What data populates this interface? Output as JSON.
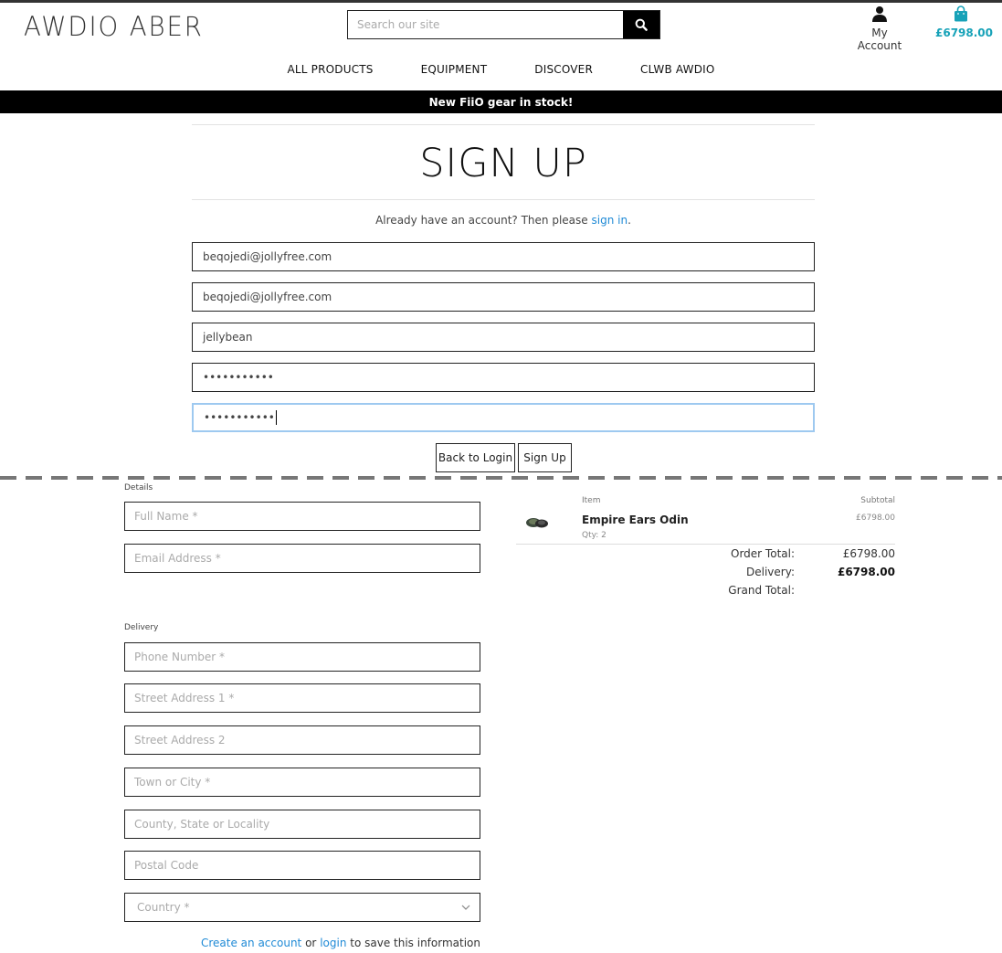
{
  "header": {
    "logo": "AWDIO ABER",
    "search_placeholder": "Search our site",
    "account_label": "My Account",
    "bag_total": "£6798.00"
  },
  "nav": {
    "items": [
      "ALL PRODUCTS",
      "EQUIPMENT",
      "DISCOVER",
      "CLWB AWDIO"
    ]
  },
  "banner": "New FiiO gear in stock!",
  "signup": {
    "title": "SIGN UP",
    "already_text": "Already have an account? Then please",
    "sign_in_link": "sign in",
    "period": ".",
    "email": "beqojedi@jollyfree.com",
    "email_confirm": "beqojedi@jollyfree.com",
    "username": "jellybean",
    "password": "•••••••••••",
    "password_confirm": "•••••••••••",
    "back_button": "Back to Login",
    "signup_button": "Sign Up"
  },
  "checkout": {
    "details_label": "Details",
    "full_name_placeholder": "Full Name *",
    "email_placeholder": "Email Address *",
    "delivery_label": "Delivery",
    "phone_placeholder": "Phone Number *",
    "street1_placeholder": "Street Address 1 *",
    "street2_placeholder": "Street Address 2",
    "town_placeholder": "Town or City *",
    "county_placeholder": "County, State or Locality",
    "postcode_placeholder": "Postal Code",
    "country_placeholder": "Country *",
    "save_create": "Create an account",
    "save_or": "or",
    "save_login": "login",
    "save_rest": "to save this information"
  },
  "summary": {
    "item_header": "Item",
    "subtotal_header": "Subtotal",
    "item_name": "Empire Ears Odin",
    "item_qty": "Qty: 2",
    "item_subtotal": "£6798.00",
    "order_total_label": "Order Total:",
    "order_total_value": "£6798.00",
    "delivery_label": "Delivery:",
    "delivery_value": "£6798.00",
    "grand_total_label": "Grand Total:"
  },
  "colors": {
    "accent": "#17a2b8",
    "link": "#1f8ad6",
    "banner_bg": "#000000",
    "focus_border": "#9ec9f0"
  },
  "icons": {
    "search": "search-icon",
    "account": "user-icon",
    "bag": "shopping-bag-icon",
    "country_select": "chevron-down-icon"
  }
}
